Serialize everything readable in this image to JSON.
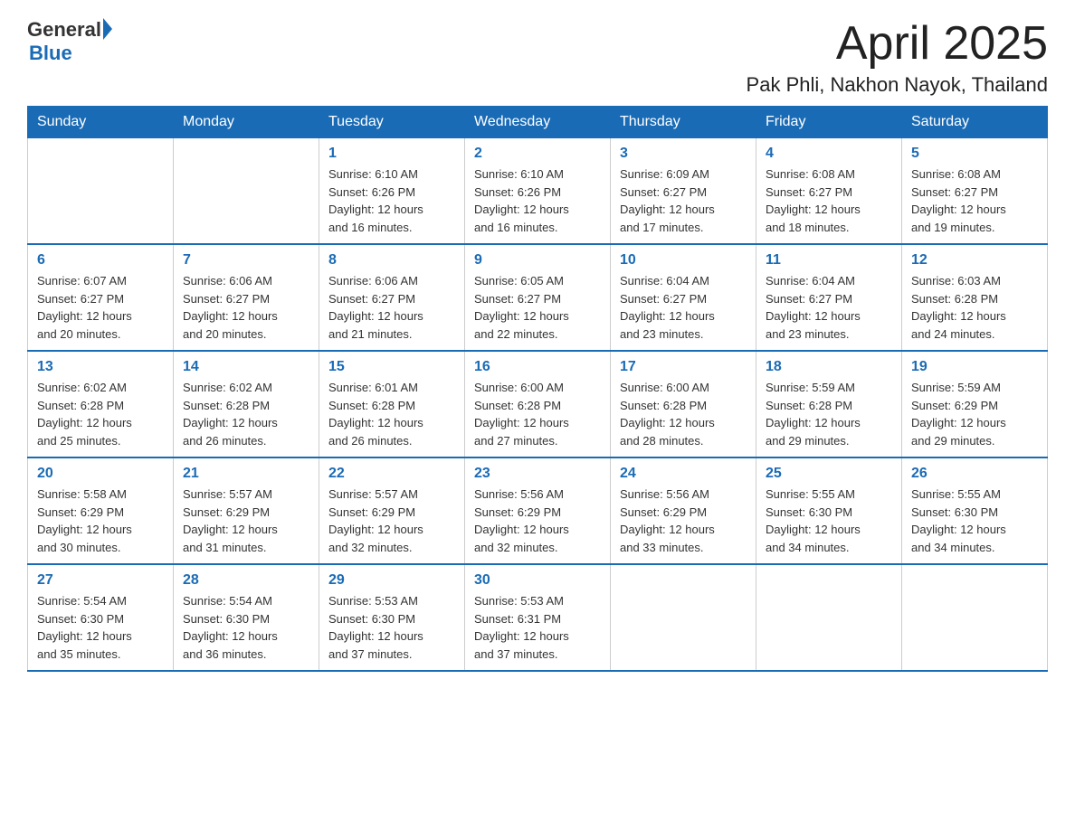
{
  "header": {
    "logo_general": "General",
    "logo_blue": "Blue",
    "month_title": "April 2025",
    "location": "Pak Phli, Nakhon Nayok, Thailand"
  },
  "days_of_week": [
    "Sunday",
    "Monday",
    "Tuesday",
    "Wednesday",
    "Thursday",
    "Friday",
    "Saturday"
  ],
  "weeks": [
    {
      "days": [
        {
          "num": "",
          "info": ""
        },
        {
          "num": "",
          "info": ""
        },
        {
          "num": "1",
          "info": "Sunrise: 6:10 AM\nSunset: 6:26 PM\nDaylight: 12 hours\nand 16 minutes."
        },
        {
          "num": "2",
          "info": "Sunrise: 6:10 AM\nSunset: 6:26 PM\nDaylight: 12 hours\nand 16 minutes."
        },
        {
          "num": "3",
          "info": "Sunrise: 6:09 AM\nSunset: 6:27 PM\nDaylight: 12 hours\nand 17 minutes."
        },
        {
          "num": "4",
          "info": "Sunrise: 6:08 AM\nSunset: 6:27 PM\nDaylight: 12 hours\nand 18 minutes."
        },
        {
          "num": "5",
          "info": "Sunrise: 6:08 AM\nSunset: 6:27 PM\nDaylight: 12 hours\nand 19 minutes."
        }
      ]
    },
    {
      "days": [
        {
          "num": "6",
          "info": "Sunrise: 6:07 AM\nSunset: 6:27 PM\nDaylight: 12 hours\nand 20 minutes."
        },
        {
          "num": "7",
          "info": "Sunrise: 6:06 AM\nSunset: 6:27 PM\nDaylight: 12 hours\nand 20 minutes."
        },
        {
          "num": "8",
          "info": "Sunrise: 6:06 AM\nSunset: 6:27 PM\nDaylight: 12 hours\nand 21 minutes."
        },
        {
          "num": "9",
          "info": "Sunrise: 6:05 AM\nSunset: 6:27 PM\nDaylight: 12 hours\nand 22 minutes."
        },
        {
          "num": "10",
          "info": "Sunrise: 6:04 AM\nSunset: 6:27 PM\nDaylight: 12 hours\nand 23 minutes."
        },
        {
          "num": "11",
          "info": "Sunrise: 6:04 AM\nSunset: 6:27 PM\nDaylight: 12 hours\nand 23 minutes."
        },
        {
          "num": "12",
          "info": "Sunrise: 6:03 AM\nSunset: 6:28 PM\nDaylight: 12 hours\nand 24 minutes."
        }
      ]
    },
    {
      "days": [
        {
          "num": "13",
          "info": "Sunrise: 6:02 AM\nSunset: 6:28 PM\nDaylight: 12 hours\nand 25 minutes."
        },
        {
          "num": "14",
          "info": "Sunrise: 6:02 AM\nSunset: 6:28 PM\nDaylight: 12 hours\nand 26 minutes."
        },
        {
          "num": "15",
          "info": "Sunrise: 6:01 AM\nSunset: 6:28 PM\nDaylight: 12 hours\nand 26 minutes."
        },
        {
          "num": "16",
          "info": "Sunrise: 6:00 AM\nSunset: 6:28 PM\nDaylight: 12 hours\nand 27 minutes."
        },
        {
          "num": "17",
          "info": "Sunrise: 6:00 AM\nSunset: 6:28 PM\nDaylight: 12 hours\nand 28 minutes."
        },
        {
          "num": "18",
          "info": "Sunrise: 5:59 AM\nSunset: 6:28 PM\nDaylight: 12 hours\nand 29 minutes."
        },
        {
          "num": "19",
          "info": "Sunrise: 5:59 AM\nSunset: 6:29 PM\nDaylight: 12 hours\nand 29 minutes."
        }
      ]
    },
    {
      "days": [
        {
          "num": "20",
          "info": "Sunrise: 5:58 AM\nSunset: 6:29 PM\nDaylight: 12 hours\nand 30 minutes."
        },
        {
          "num": "21",
          "info": "Sunrise: 5:57 AM\nSunset: 6:29 PM\nDaylight: 12 hours\nand 31 minutes."
        },
        {
          "num": "22",
          "info": "Sunrise: 5:57 AM\nSunset: 6:29 PM\nDaylight: 12 hours\nand 32 minutes."
        },
        {
          "num": "23",
          "info": "Sunrise: 5:56 AM\nSunset: 6:29 PM\nDaylight: 12 hours\nand 32 minutes."
        },
        {
          "num": "24",
          "info": "Sunrise: 5:56 AM\nSunset: 6:29 PM\nDaylight: 12 hours\nand 33 minutes."
        },
        {
          "num": "25",
          "info": "Sunrise: 5:55 AM\nSunset: 6:30 PM\nDaylight: 12 hours\nand 34 minutes."
        },
        {
          "num": "26",
          "info": "Sunrise: 5:55 AM\nSunset: 6:30 PM\nDaylight: 12 hours\nand 34 minutes."
        }
      ]
    },
    {
      "days": [
        {
          "num": "27",
          "info": "Sunrise: 5:54 AM\nSunset: 6:30 PM\nDaylight: 12 hours\nand 35 minutes."
        },
        {
          "num": "28",
          "info": "Sunrise: 5:54 AM\nSunset: 6:30 PM\nDaylight: 12 hours\nand 36 minutes."
        },
        {
          "num": "29",
          "info": "Sunrise: 5:53 AM\nSunset: 6:30 PM\nDaylight: 12 hours\nand 37 minutes."
        },
        {
          "num": "30",
          "info": "Sunrise: 5:53 AM\nSunset: 6:31 PM\nDaylight: 12 hours\nand 37 minutes."
        },
        {
          "num": "",
          "info": ""
        },
        {
          "num": "",
          "info": ""
        },
        {
          "num": "",
          "info": ""
        }
      ]
    }
  ]
}
